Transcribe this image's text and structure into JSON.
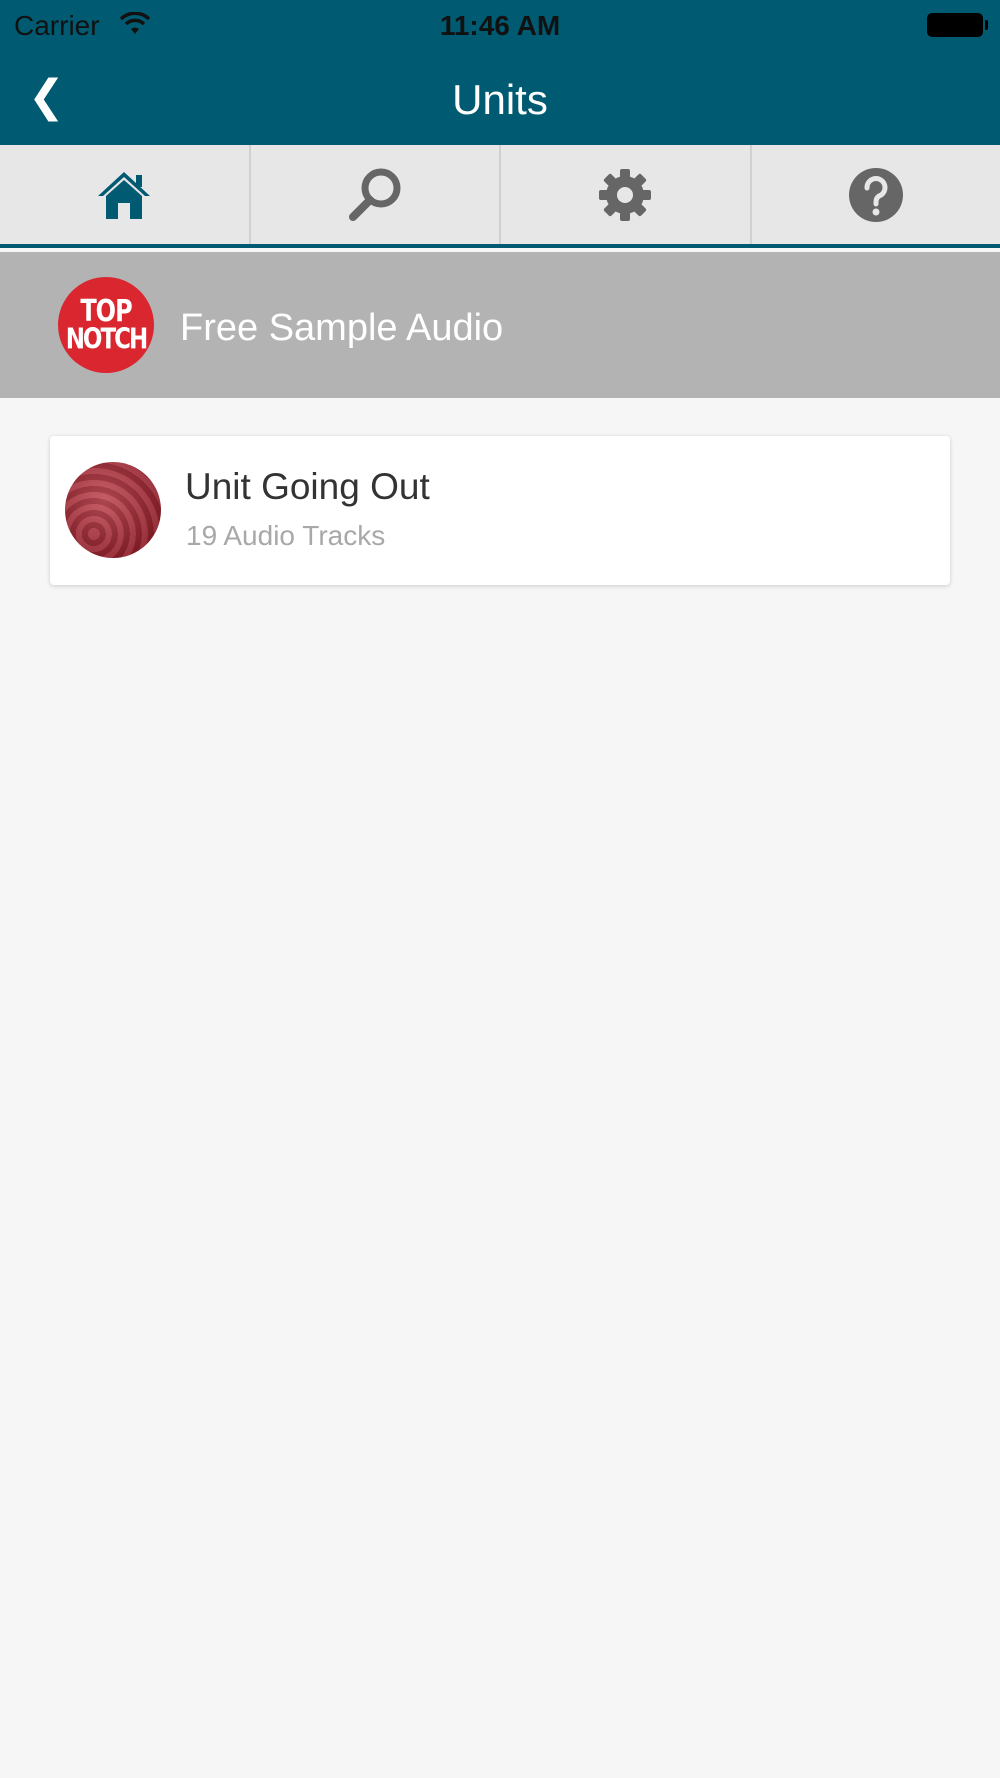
{
  "status_bar": {
    "carrier": "Carrier",
    "time": "11:46 AM"
  },
  "nav": {
    "back_label": "❮",
    "title": "Units"
  },
  "tabs": [
    {
      "name": "home",
      "icon": "home-icon",
      "active": true
    },
    {
      "name": "search",
      "icon": "search-icon",
      "active": false
    },
    {
      "name": "settings",
      "icon": "gear-icon",
      "active": false
    },
    {
      "name": "help",
      "icon": "help-icon",
      "active": false
    }
  ],
  "banner": {
    "logo_line1": "TOP",
    "logo_line2": "NOTCH",
    "title": "Free Sample Audio"
  },
  "units": [
    {
      "title": "Unit Going Out",
      "subtitle": "19 Audio Tracks"
    }
  ],
  "colors": {
    "header": "#005a72",
    "tabbar": "#e8e7e8",
    "banner": "#b3b3b3",
    "logo": "#d9262f",
    "active_icon": "#005a72",
    "inactive_icon": "#666666"
  }
}
